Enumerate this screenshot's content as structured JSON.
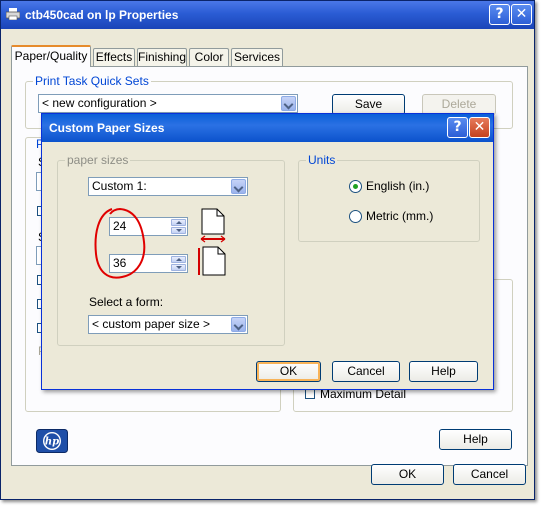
{
  "outer_window": {
    "title": "ctb450cad on lp Properties",
    "help_glyph": "?",
    "close_glyph": "✕",
    "tabs": [
      {
        "label": "Paper/Quality",
        "active": true
      },
      {
        "label": "Effects"
      },
      {
        "label": "Finishing"
      },
      {
        "label": "Color"
      },
      {
        "label": "Services"
      }
    ],
    "quick_sets": {
      "label": "Print Task Quick Sets",
      "selected": "< new configuration >",
      "save_label": "Save",
      "delete_label": "Delete"
    },
    "partial": {
      "p1": "P",
      "s1": "S",
      "s2": "S",
      "p2": "P"
    },
    "maximum_detail_label": "Maximum Detail",
    "help_button": "Help",
    "ok_button": "OK",
    "cancel_button": "Cancel",
    "logo_text": "hp",
    "icons": [
      "printer-icon",
      "help-icon",
      "close-icon",
      "hp-logo"
    ]
  },
  "dialog": {
    "title": "Custom Paper Sizes",
    "help_glyph": "?",
    "close_glyph": "✕",
    "paper_sizes_label": "paper sizes",
    "size_selected": "Custom 1:",
    "width_value": "24",
    "height_value": "36",
    "select_form_label": "Select a form:",
    "form_selected": "< custom paper size >",
    "units_label": "Units",
    "units": [
      {
        "label": "English (in.)",
        "checked": true
      },
      {
        "label": "Metric (mm.)",
        "checked": false
      }
    ],
    "ok_button": "OK",
    "cancel_button": "Cancel",
    "help_button": "Help",
    "annotation_color": "#e00000",
    "icons": [
      "page-width-icon",
      "page-height-icon",
      "red-circle-annotation"
    ]
  },
  "colors": {
    "title_blue": "#2a5cd4",
    "group_label": "#0046d5",
    "window_bg": "#ece9d8",
    "tab_highlight": "#e68b2c"
  }
}
